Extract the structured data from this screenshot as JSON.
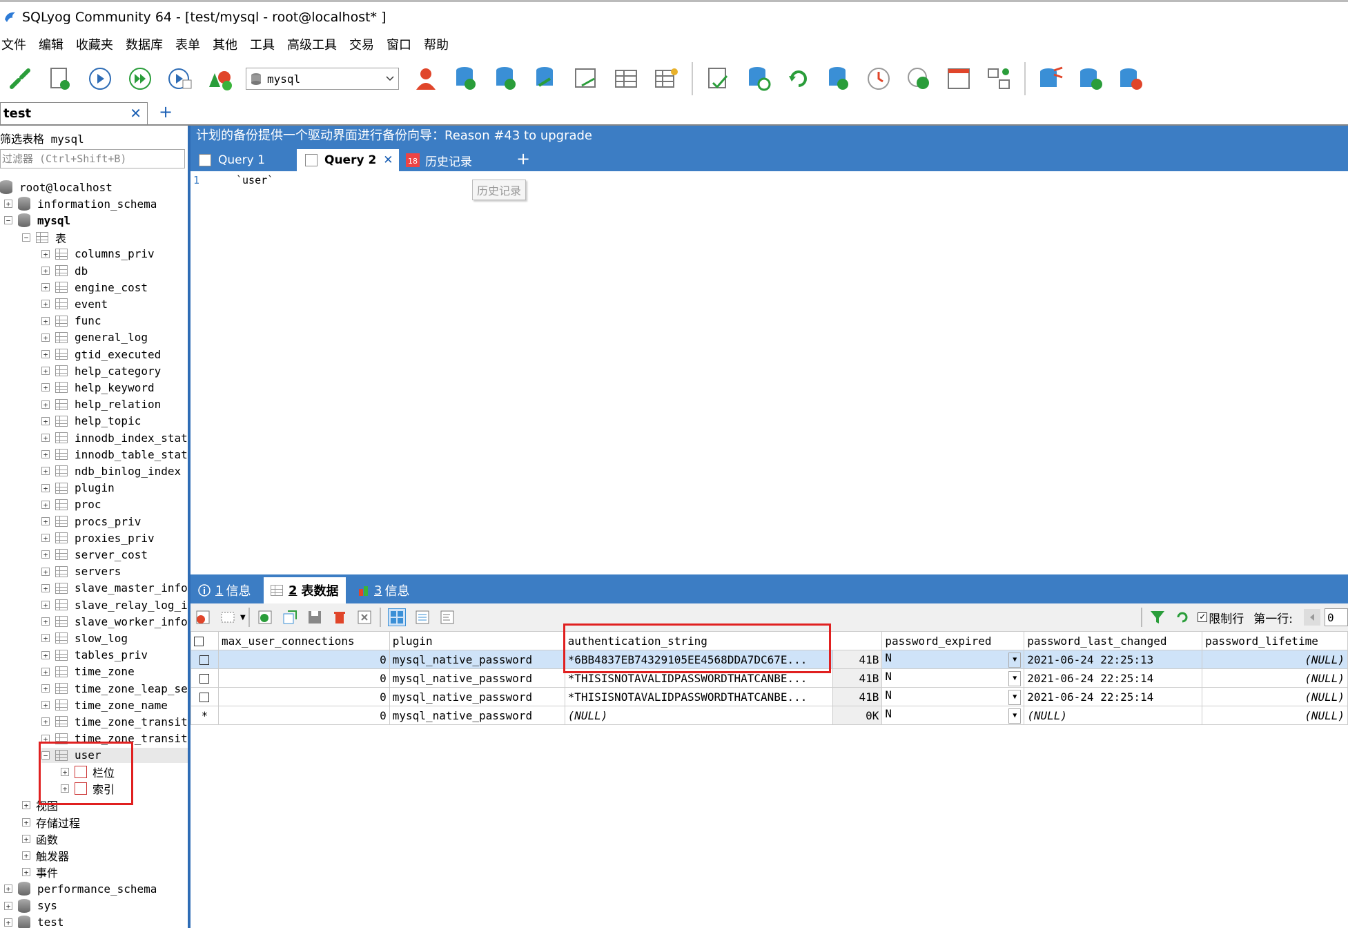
{
  "window": {
    "title": "SQLyog Community 64 - [test/mysql - root@localhost* ]"
  },
  "menu": [
    "文件",
    "编辑",
    "收藏夹",
    "数据库",
    "表单",
    "其他",
    "工具",
    "高级工具",
    "交易",
    "窗口",
    "帮助"
  ],
  "toolbar": {
    "db_select": "mysql"
  },
  "connection_tab": {
    "label": "test",
    "close": "✕",
    "add": "+"
  },
  "object_browser": {
    "filter_label": "筛选表格 mysql",
    "filter_placeholder": "过滤器 (Ctrl+Shift+B)",
    "root": "root@localhost",
    "databases_top": [
      "information_schema",
      "mysql"
    ],
    "tables_folder": "表",
    "tables": [
      "columns_priv",
      "db",
      "engine_cost",
      "event",
      "func",
      "general_log",
      "gtid_executed",
      "help_category",
      "help_keyword",
      "help_relation",
      "help_topic",
      "innodb_index_stats",
      "innodb_table_stats",
      "ndb_binlog_index",
      "plugin",
      "proc",
      "procs_priv",
      "proxies_priv",
      "server_cost",
      "servers",
      "slave_master_info",
      "slave_relay_log_info",
      "slave_worker_info",
      "slow_log",
      "tables_priv",
      "time_zone",
      "time_zone_leap_second",
      "time_zone_name",
      "time_zone_transition",
      "time_zone_transition_type",
      "user"
    ],
    "user_children": [
      "栏位",
      "索引"
    ],
    "folders": [
      "视图",
      "存储过程",
      "函数",
      "触发器",
      "事件"
    ],
    "databases_bottom": [
      "performance_schema",
      "sys",
      "test"
    ]
  },
  "banner": "计划的备份提供一个驱动界面进行备份向导：Reason #43 to upgrade",
  "query_tabs": [
    {
      "label": "Query 1"
    },
    {
      "label": "Query 2",
      "close": "✕"
    },
    {
      "label": "历史记录",
      "badge": "18"
    }
  ],
  "query_tab_add": "+",
  "editor": {
    "line_number": "1",
    "text": "`user`",
    "tooltip": "历史记录"
  },
  "result_tabs": [
    {
      "num": "1",
      "label": "信息"
    },
    {
      "num": "2",
      "label": "表数据"
    },
    {
      "num": "3",
      "label": "信息"
    }
  ],
  "result_toolbar": {
    "limit_label": "限制行",
    "first_row_label": "第一行:",
    "first_row_value": "0"
  },
  "grid": {
    "columns": [
      "max_user_connections",
      "plugin",
      "authentication_string",
      "",
      "password_expired",
      "password_last_changed",
      "password_lifetime"
    ],
    "rows": [
      {
        "marker": "",
        "max_user_connections": "0",
        "plugin": "mysql_native_password",
        "authentication_string": "*6BB4837EB74329105EE4568DDA7DC67E...",
        "size": "41B",
        "password_expired": "N",
        "password_last_changed": "2021-06-24 22:25:13",
        "password_lifetime": "(NULL)"
      },
      {
        "marker": "",
        "max_user_connections": "0",
        "plugin": "mysql_native_password",
        "authentication_string": "*THISISNOTAVALIDPASSWORDTHATCANBE...",
        "size": "41B",
        "password_expired": "N",
        "password_last_changed": "2021-06-24 22:25:14",
        "password_lifetime": "(NULL)"
      },
      {
        "marker": "",
        "max_user_connections": "0",
        "plugin": "mysql_native_password",
        "authentication_string": "*THISISNOTAVALIDPASSWORDTHATCANBE...",
        "size": "41B",
        "password_expired": "N",
        "password_last_changed": "2021-06-24 22:25:14",
        "password_lifetime": "(NULL)"
      },
      {
        "marker": "*",
        "max_user_connections": "0",
        "plugin": "mysql_native_password",
        "authentication_string": "(NULL)",
        "size": "0K",
        "password_expired": "N",
        "password_last_changed": "(NULL)",
        "password_lifetime": "(NULL)"
      }
    ]
  },
  "colors": {
    "accent": "#3c7dc4",
    "highlight_box": "#e02020",
    "selected_row": "#cfe3f8"
  }
}
